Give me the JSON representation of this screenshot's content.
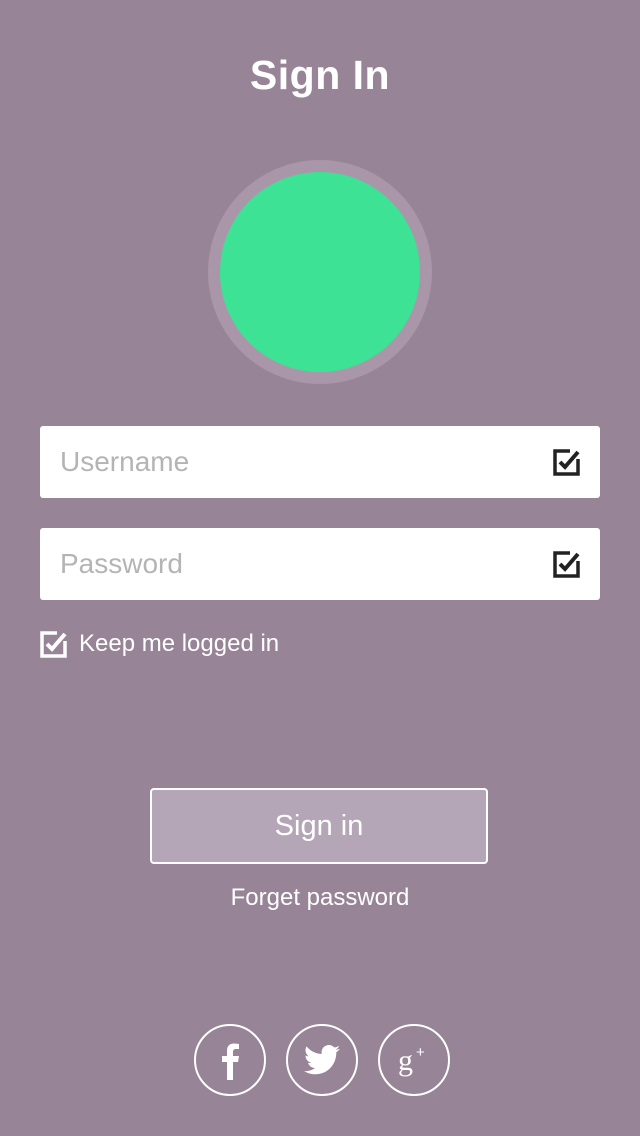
{
  "header": {
    "title": "Sign In"
  },
  "avatar": {
    "color": "#3de295"
  },
  "form": {
    "username_placeholder": "Username",
    "password_placeholder": "Password",
    "username_icon": "checkbox-checked-icon",
    "password_icon": "checkbox-checked-icon"
  },
  "remember": {
    "label": "Keep me logged in",
    "checked": true
  },
  "actions": {
    "signin_label": "Sign in",
    "forget_label": "Forget password"
  },
  "social": {
    "items": [
      {
        "name": "facebook",
        "icon": "facebook-icon"
      },
      {
        "name": "twitter",
        "icon": "twitter-icon"
      },
      {
        "name": "google-plus",
        "icon": "google-plus-icon"
      }
    ]
  },
  "colors": {
    "background": "#978497",
    "avatar_ring": "#a996a9",
    "button_fill": "#b4a6b6",
    "text": "#ffffff"
  }
}
